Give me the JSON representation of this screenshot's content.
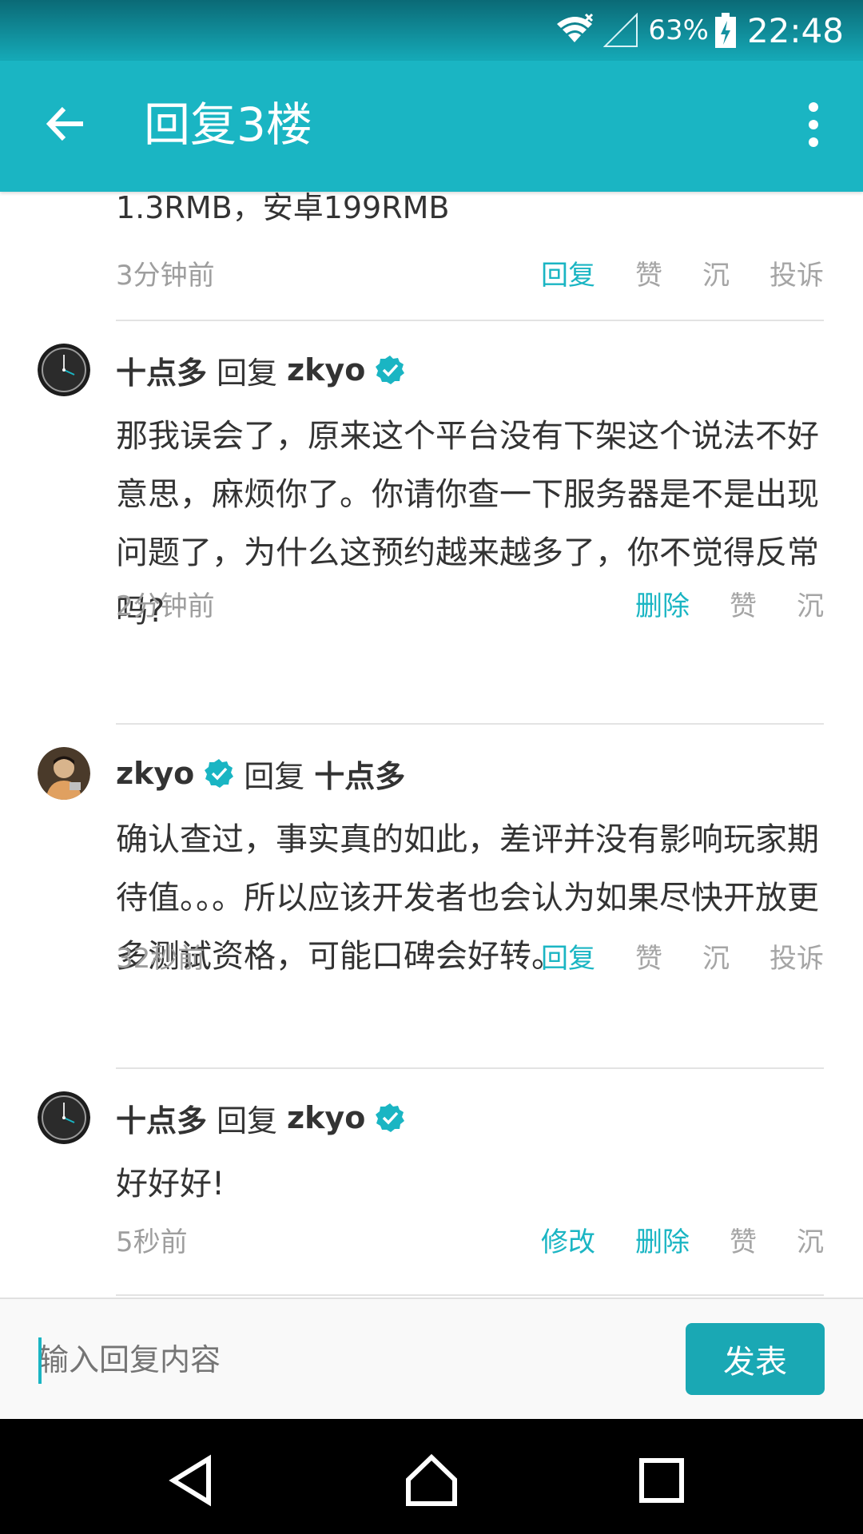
{
  "status_bar": {
    "battery_percent": "63%",
    "time": "22:48"
  },
  "app_bar": {
    "title": "回复3楼"
  },
  "partial_comment": {
    "text_tail": "1.3RMB，安卓199RMB",
    "time": "3分钟前",
    "actions": [
      "回复",
      "赞",
      "沉",
      "投诉"
    ]
  },
  "comments": [
    {
      "user": "十点多",
      "reply_word": "回复",
      "target": "zkyo",
      "target_verified": true,
      "body": "那我误会了，原来这个平台没有下架这个说法不好意思，麻烦你了。你请你查一下服务器是不是出现问题了，为什么这预约越来越多了，你不觉得反常吗?",
      "time": "2分钟前",
      "actions": [
        "删除",
        "赞",
        "沉"
      ]
    },
    {
      "user": "zkyo",
      "user_verified": true,
      "reply_word": "回复",
      "target": "十点多",
      "body": "确认查过，事实真的如此，差评并没有影响玩家期待值。。。所以应该开发者也会认为如果尽快开放更多测试资格，可能口碑会好转。",
      "time": "32秒前",
      "actions": [
        "回复",
        "赞",
        "沉",
        "投诉"
      ]
    },
    {
      "user": "十点多",
      "reply_word": "回复",
      "target": "zkyo",
      "target_verified": true,
      "body": "好好好!",
      "time": "5秒前",
      "actions": [
        "修改",
        "删除",
        "赞",
        "沉"
      ]
    }
  ],
  "input_bar": {
    "placeholder": "输入回复内容",
    "send_label": "发表"
  },
  "colors": {
    "accent": "#1ab5c3",
    "app_bar": "#1ab5c3",
    "send_button": "#1aa8b4",
    "muted_text": "#a5a5a5"
  },
  "icons": {
    "back": "arrow-left-icon",
    "more": "more-vert-icon",
    "verified": "verified-check-icon",
    "nav": [
      "nav-back-icon",
      "nav-home-icon",
      "nav-recents-icon"
    ]
  }
}
